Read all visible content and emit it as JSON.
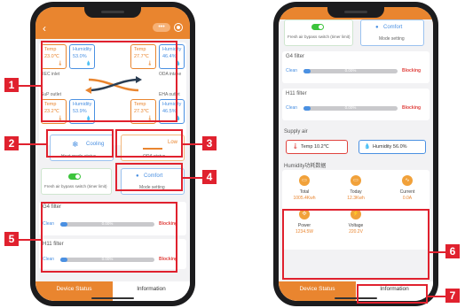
{
  "left_screen": {
    "sensors_top": [
      {
        "label": "Temp",
        "value": "23.0℃",
        "color": "orange"
      },
      {
        "label": "Humidity",
        "value": "53.0%",
        "color": "blue"
      },
      {
        "label": "Temp",
        "value": "27.7℃",
        "color": "orange"
      },
      {
        "label": "Humidity",
        "value": "46.4%",
        "color": "blue"
      }
    ],
    "sensors_bottom": [
      {
        "label": "Temp",
        "value": "23.2℃",
        "color": "orange"
      },
      {
        "label": "Humidity",
        "value": "53.9%",
        "color": "blue"
      },
      {
        "label": "Temp",
        "value": "27.3℃",
        "color": "orange"
      },
      {
        "label": "Humidity",
        "value": "46.5%",
        "color": "blue"
      }
    ],
    "labels": {
      "rec_inlet": "REC inlet",
      "oda_intake": "ODA intake",
      "sup_outlet": "SuP outlet",
      "eha_outlet": "EHA outlet"
    },
    "heat_mode": {
      "value": "Cooling",
      "label": "Heat mode status"
    },
    "oda_status": {
      "value": "Low",
      "label": "ODA status"
    },
    "bypass": {
      "label": "Fresh air bypass switch (timer limit)"
    },
    "mode": {
      "value": "Comfort",
      "label": "Mode setting"
    },
    "g4": {
      "title": "G4 filter",
      "clean": "Clean",
      "percent": "0.00%",
      "blocking": "Blocking"
    },
    "h11": {
      "title": "H11 filter",
      "clean": "Clean",
      "percent": "0.00%",
      "blocking": "Blocking"
    }
  },
  "right_screen": {
    "bypass": {
      "label": "Fresh air bypass switch (timer limit)"
    },
    "mode": {
      "value": "Comfort",
      "label": "Mode setting"
    },
    "g4": {
      "title": "G4 filter",
      "clean": "Clean",
      "percent": "0.00%",
      "blocking": "Blocking"
    },
    "h11": {
      "title": "H11 filter",
      "clean": "Clean",
      "percent": "0.00%",
      "blocking": "Blocking"
    },
    "supply_air": {
      "title": "Supply air",
      "temp": "Temp 10.2℃",
      "humidity": "Humidity 56.0%"
    },
    "humidity_data": {
      "title": "Humidity功耗数据"
    },
    "stats": [
      {
        "label": "Total",
        "value": "1005.4Kwh"
      },
      {
        "label": "Today",
        "value": "12.3Kwh"
      },
      {
        "label": "Current",
        "value": "0.0A"
      },
      {
        "label": "Power",
        "value": "1234.5W"
      },
      {
        "label": "Voltage",
        "value": "220.2V"
      }
    ]
  },
  "tabs": {
    "device_status": "Device Status",
    "information": "Information"
  },
  "markers": [
    "1",
    "2",
    "3",
    "4",
    "5",
    "6",
    "7"
  ],
  "colors": {
    "accent": "#e9852f",
    "blue": "#4a90e2",
    "red_annotation": "#e0212e"
  }
}
